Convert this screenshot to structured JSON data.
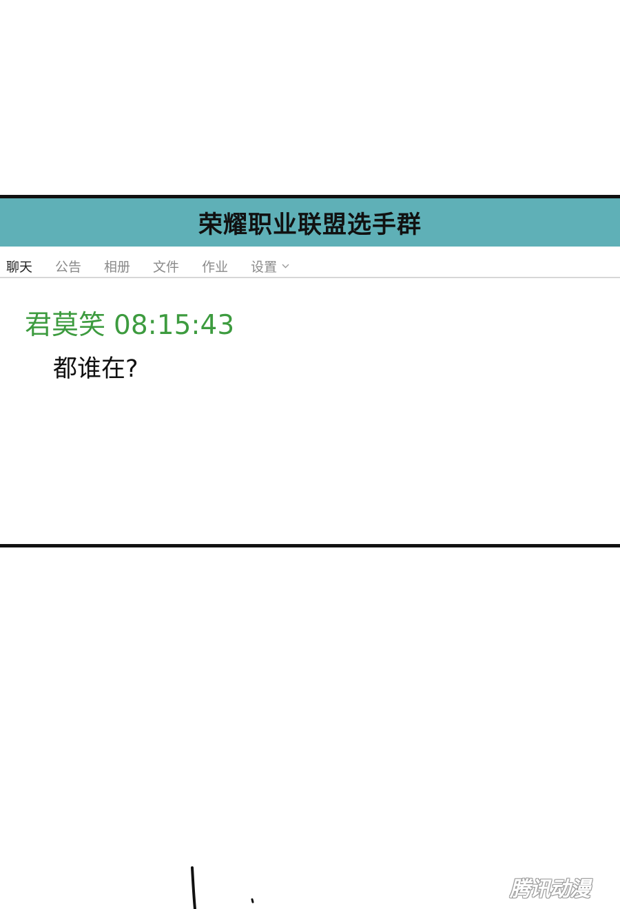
{
  "group": {
    "title": "荣耀职业联盟选手群"
  },
  "tabs": [
    {
      "label": "聊天",
      "active": true
    },
    {
      "label": "公告",
      "active": false
    },
    {
      "label": "相册",
      "active": false
    },
    {
      "label": "文件",
      "active": false
    },
    {
      "label": "作业",
      "active": false
    },
    {
      "label": "设置",
      "active": false
    }
  ],
  "message": {
    "sender": "君莫笑",
    "time": "08:15:43",
    "text": "都谁在?"
  },
  "watermark": {
    "text": "腾讯动漫"
  },
  "colors": {
    "title_bar": "#5fb0b7",
    "sender": "#3d9b3f",
    "border": "#111111"
  },
  "icons": {
    "settings_dropdown": "chevron-down-icon"
  }
}
